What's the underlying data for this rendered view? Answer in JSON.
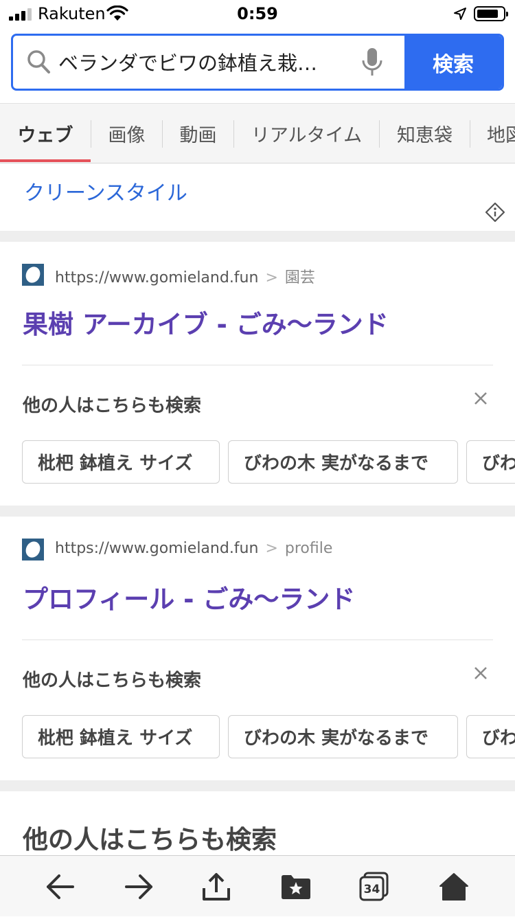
{
  "status_bar": {
    "carrier": "Rakuten",
    "time": "0:59"
  },
  "search": {
    "query": "ベランダでビワの鉢植え栽…",
    "button_label": "検索"
  },
  "tabs": [
    {
      "label": "ウェブ",
      "active": true
    },
    {
      "label": "画像",
      "active": false
    },
    {
      "label": "動画",
      "active": false
    },
    {
      "label": "リアルタイム",
      "active": false
    },
    {
      "label": "知恵袋",
      "active": false
    },
    {
      "label": "地図",
      "active": false
    }
  ],
  "clean_style": {
    "link_text": "クリーンスタイル"
  },
  "results": [
    {
      "url": "https://www.gomieland.fun",
      "breadcrumb": "園芸",
      "title": "果樹 アーカイブ - ごみ〜ランド",
      "related_heading": "他の人はこちらも検索",
      "chips": [
        "枇杷 鉢植え サイズ",
        "びわの木 実がなるまで",
        "びわ"
      ]
    },
    {
      "url": "https://www.gomieland.fun",
      "breadcrumb": "profile",
      "title": "プロフィール - ごみ〜ランド",
      "related_heading": "他の人はこちらも検索",
      "chips": [
        "枇杷 鉢植え サイズ",
        "びわの木 実がなるまで",
        "びわ"
      ]
    }
  ],
  "more_related": {
    "heading": "他の人はこちらも検索"
  },
  "toolbar": {
    "tab_count": "34"
  },
  "colors": {
    "accent_blue": "#2e6cf0",
    "link_blue": "#2b67d8",
    "title_purple": "#5b3fb0",
    "active_tab_underline": "#e5525a"
  }
}
